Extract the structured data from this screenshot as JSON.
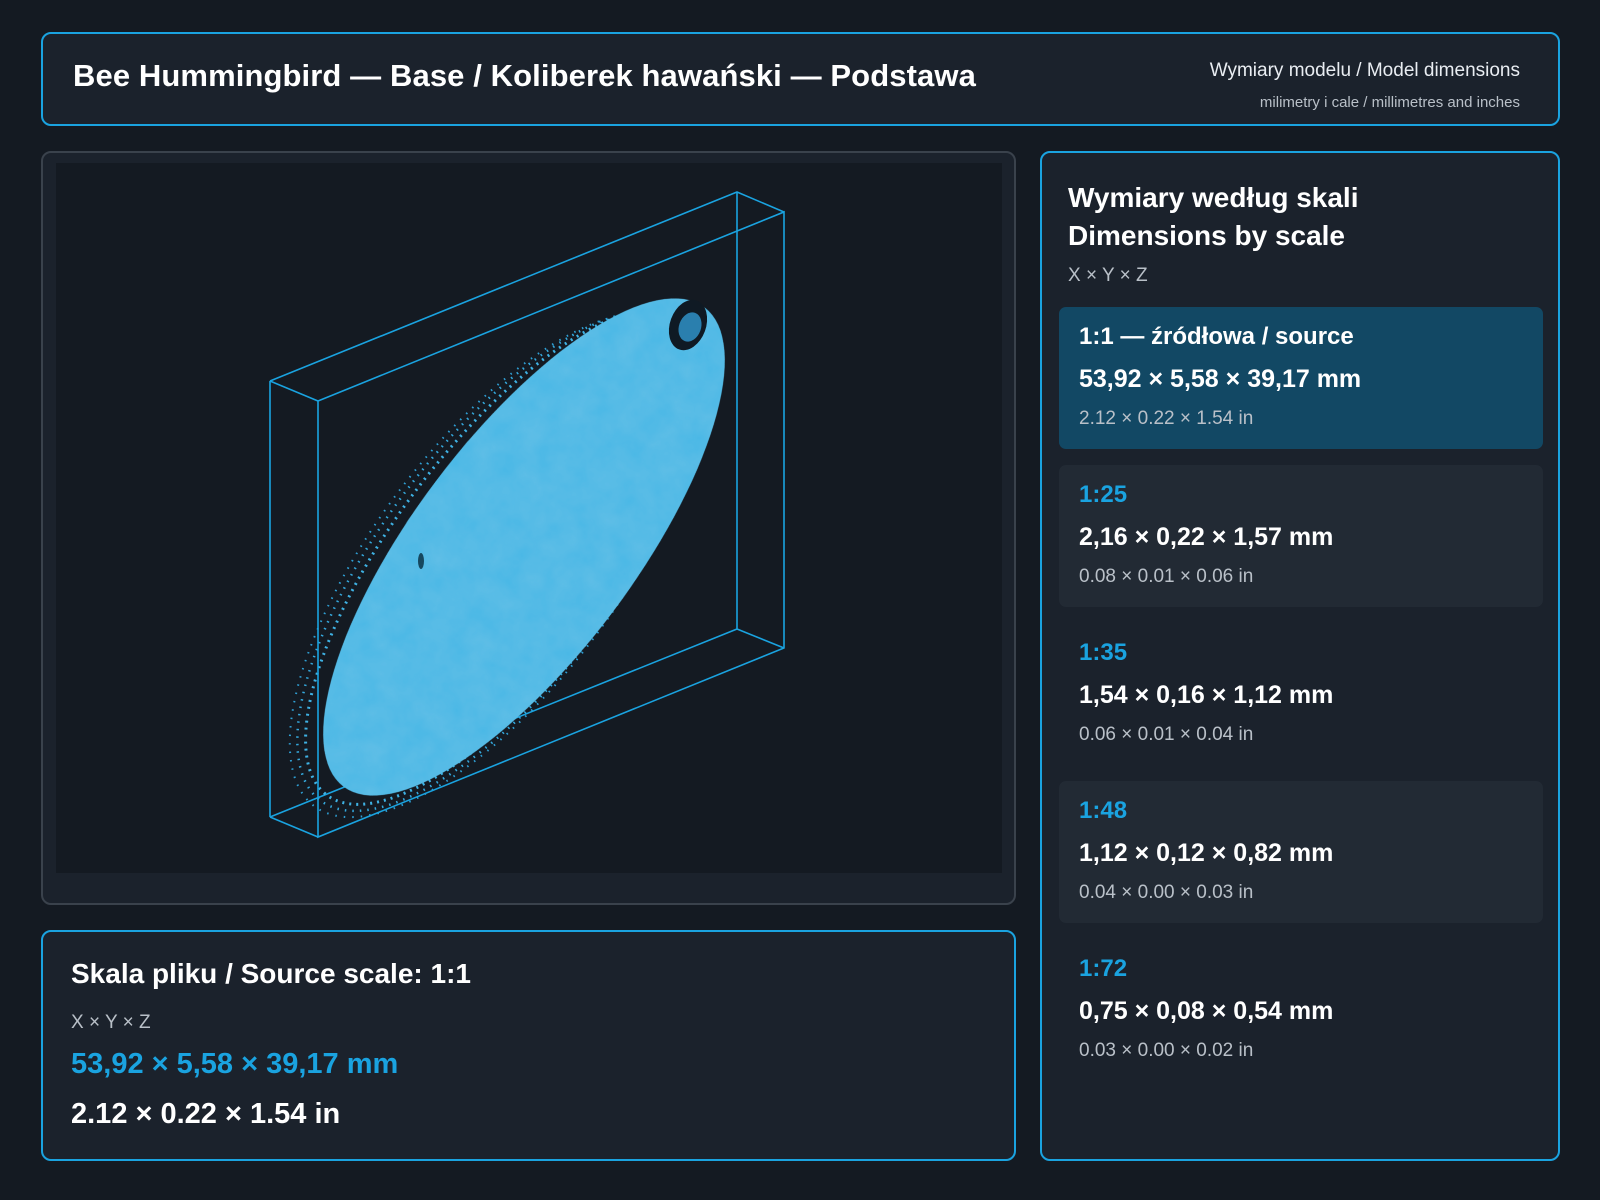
{
  "header": {
    "title": "Bee Hummingbird — Base / Koliberek hawański — Podstawa",
    "subtitle": "Wymiary modelu / Model dimensions",
    "units_note": "milimetry i cale / millimetres and inches"
  },
  "viewer": {
    "model_icon": "point-cloud-model",
    "accent_color": "#1aa3e0",
    "model_color": "#4ab8e6"
  },
  "source": {
    "title": "Skala pliku / Source scale: 1:1",
    "axes": "X × Y × Z",
    "mm": "53,92 × 5,58 × 39,17 mm",
    "in": "2.12 × 0.22 × 1.54 in"
  },
  "scales": {
    "title_pl": "Wymiary według skali",
    "title_en": "Dimensions by scale",
    "axes": "X × Y × Z",
    "items": [
      {
        "ratio": "1:1  —  źródłowa / source",
        "mm": "53,92 × 5,58 × 39,17 mm",
        "in": "2.12 × 0.22 × 1.54 in"
      },
      {
        "ratio": "1:25",
        "mm": "2,16 × 0,22 × 1,57 mm",
        "in": "0.08 × 0.01 × 0.06 in"
      },
      {
        "ratio": "1:35",
        "mm": "1,54 × 0,16 × 1,12 mm",
        "in": "0.06 × 0.01 × 0.04 in"
      },
      {
        "ratio": "1:48",
        "mm": "1,12 × 0,12 × 0,82 mm",
        "in": "0.04 × 0.00 × 0.03 in"
      },
      {
        "ratio": "1:72",
        "mm": "0,75 × 0,08 × 0,54 mm",
        "in": "0.03 × 0.00 × 0.02 in"
      }
    ]
  }
}
